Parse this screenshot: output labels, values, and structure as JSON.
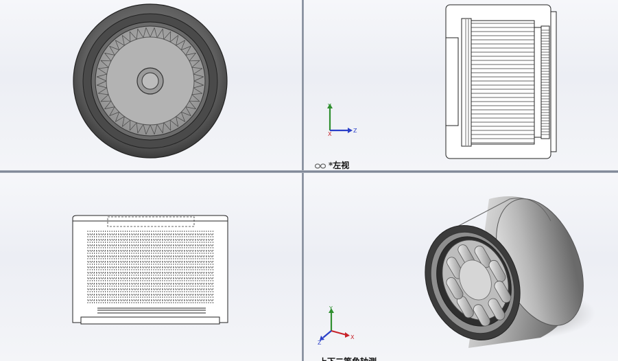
{
  "viewports": {
    "top_right_label": "*左视",
    "bottom_right_label": "上下二等角轴测"
  },
  "triad": {
    "x_label": "X",
    "y_label": "Y",
    "z_label": "Z"
  },
  "icons": {
    "view_state": "glasses-icon"
  },
  "colors": {
    "x_axis": "#c8232a",
    "y_axis": "#2f8f2f",
    "z_axis": "#2a3fc8",
    "part_dark": "#3a3a3a",
    "part_mid": "#7a7a7a",
    "part_light": "#bdbdbd"
  }
}
